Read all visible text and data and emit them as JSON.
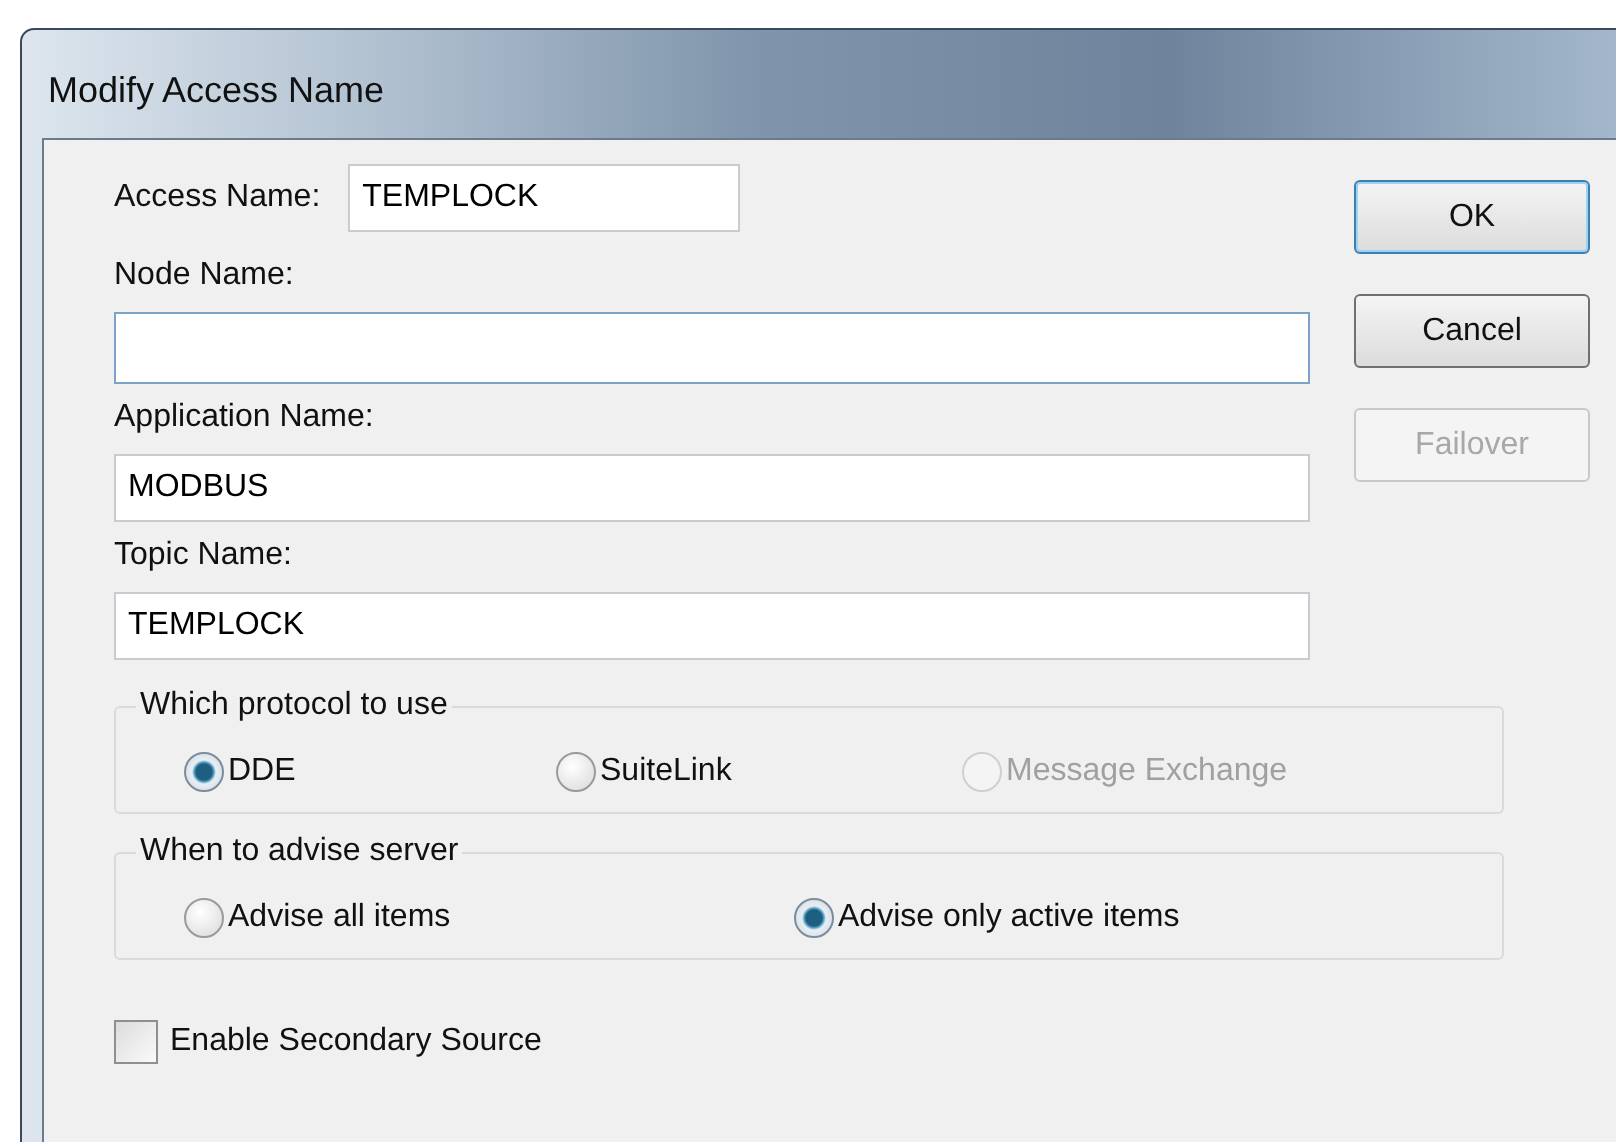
{
  "window": {
    "title": "Modify Access Name"
  },
  "fields": [
    {
      "kind": "inline",
      "label": "Access Name:",
      "value": "TEMPLOCK"
    },
    {
      "kind": "stacked",
      "label": "Node Name:"
    },
    {
      "kind": "stacked",
      "label": "Application Name:",
      "value": "MODBUS"
    },
    {
      "kind": "stacked",
      "label": "Topic Name:",
      "value": "TEMPLOCK"
    }
  ],
  "groups": [
    {
      "title": "Which protocol to use",
      "options": [
        {
          "label": "DDE",
          "selected": true,
          "disabled": false
        },
        {
          "label": "SuiteLink",
          "selected": false,
          "disabled": false
        },
        {
          "label": "Message Exchange",
          "selected": false,
          "disabled": true
        }
      ]
    },
    {
      "title": "When to advise server",
      "options": [
        {
          "label": "Advise all items",
          "selected": false,
          "disabled": false
        },
        {
          "label": "Advise only active items",
          "selected": true,
          "disabled": false
        }
      ]
    }
  ],
  "checkbox": {
    "label": "Enable Secondary Source",
    "checked": false
  },
  "buttons": [
    {
      "label": "OK",
      "default": true,
      "disabled": false
    },
    {
      "label": "Cancel",
      "default": false,
      "disabled": false
    },
    {
      "label": "Failover",
      "default": false,
      "disabled": true
    }
  ]
}
